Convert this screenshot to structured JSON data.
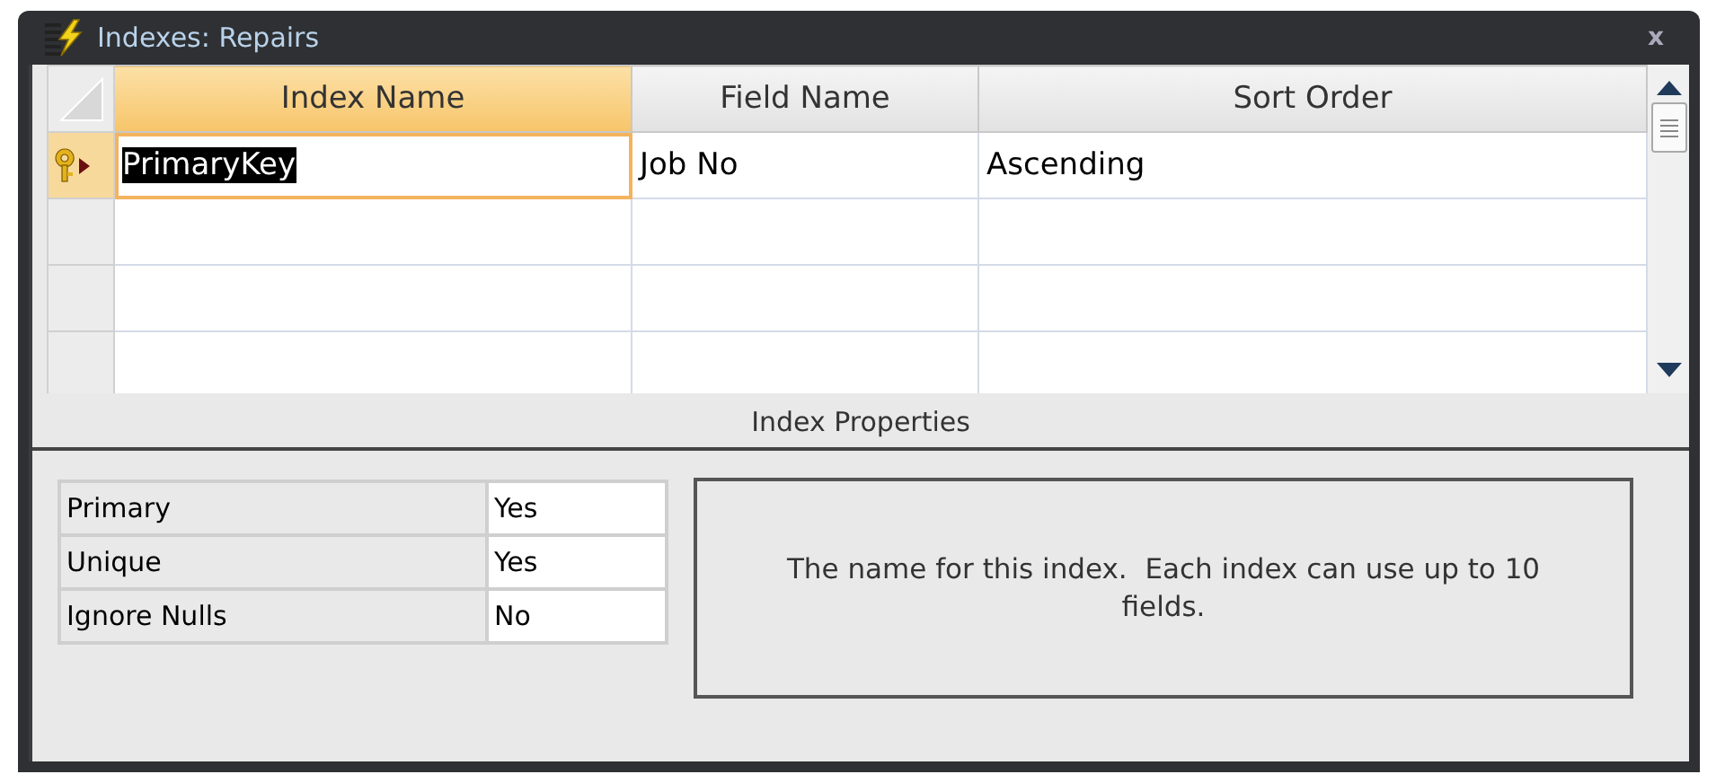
{
  "window": {
    "title": "Indexes: Repairs",
    "close": "x"
  },
  "grid": {
    "columns": [
      "Index Name",
      "Field Name",
      "Sort Order"
    ],
    "rows": [
      {
        "index_name": "PrimaryKey",
        "field_name": "Job No",
        "sort_order": "Ascending",
        "primary_key": true,
        "selected": true
      }
    ]
  },
  "properties": {
    "title": "Index Properties",
    "items": [
      {
        "label": "Primary",
        "value": "Yes"
      },
      {
        "label": "Unique",
        "value": "Yes"
      },
      {
        "label": "Ignore Nulls",
        "value": "No"
      }
    ],
    "description": "The name for this index.  Each index can use up to 10 fields."
  }
}
